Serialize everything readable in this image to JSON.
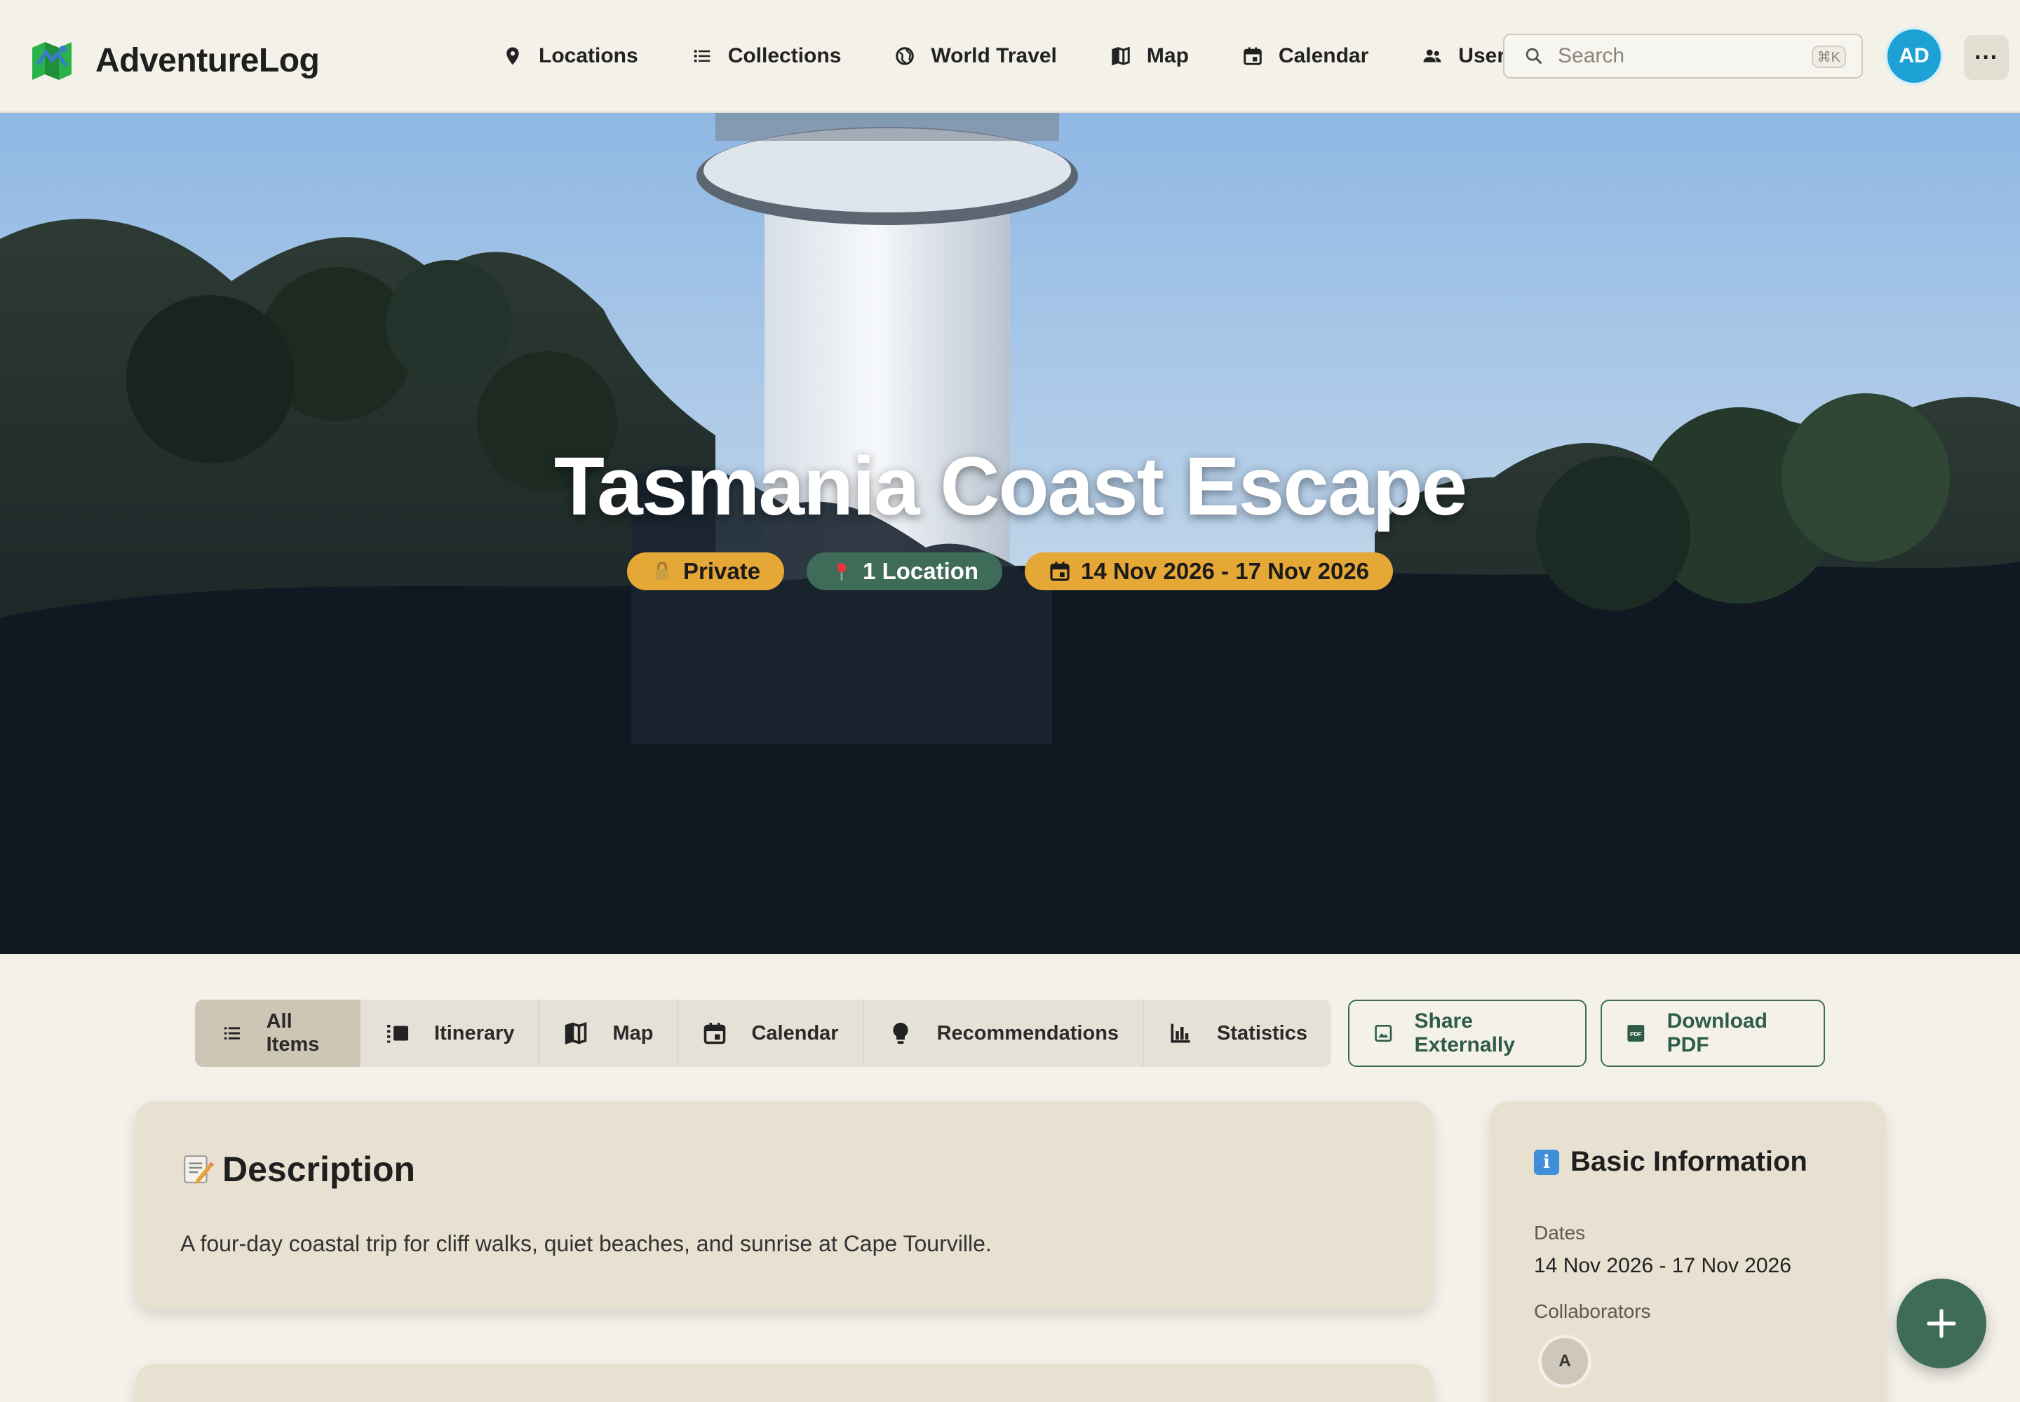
{
  "app": {
    "name": "AdventureLog"
  },
  "nav": {
    "items": [
      {
        "label": "Locations",
        "icon": "pin-icon"
      },
      {
        "label": "Collections",
        "icon": "list-icon"
      },
      {
        "label": "World Travel",
        "icon": "globe-icon"
      },
      {
        "label": "Map",
        "icon": "map-icon"
      },
      {
        "label": "Calendar",
        "icon": "calendar-icon"
      },
      {
        "label": "Users",
        "icon": "users-icon"
      }
    ],
    "search": {
      "placeholder": "Search",
      "shortcut": "⌘K"
    },
    "avatar_initials": "AD",
    "more_label": "···"
  },
  "hero": {
    "title": "Tasmania Coast Escape",
    "badges": {
      "privacy": "Private",
      "locations": "1 Location",
      "dates": "14 Nov 2026 - 17 Nov 2026"
    }
  },
  "tabs": [
    {
      "label": "All Items",
      "icon": "list-icon",
      "active": true
    },
    {
      "label": "Itinerary",
      "icon": "itinerary-icon",
      "active": false
    },
    {
      "label": "Map",
      "icon": "map-icon",
      "active": false
    },
    {
      "label": "Calendar",
      "icon": "calendar-icon",
      "active": false
    },
    {
      "label": "Recommendations",
      "icon": "lightbulb-icon",
      "active": false
    },
    {
      "label": "Statistics",
      "icon": "bar-chart-icon",
      "active": false
    }
  ],
  "actions": {
    "share": "Share Externally",
    "pdf": "Download PDF"
  },
  "description": {
    "title": "Description",
    "text": "A four-day coastal trip for cliff walks, quiet beaches, and sunrise at Cape Tourville."
  },
  "basic_info": {
    "title": "Basic Information",
    "dates_label": "Dates",
    "dates_value": "14 Nov 2026 - 17 Nov 2026",
    "collaborators_label": "Collaborators",
    "collaborator_initial": "A"
  },
  "colors": {
    "background": "#f4f1e9",
    "accent_green": "#3e6c59",
    "badge_gold": "#e5a735",
    "avatar_blue": "#1ea2d6",
    "card": "#e8e1d2"
  }
}
